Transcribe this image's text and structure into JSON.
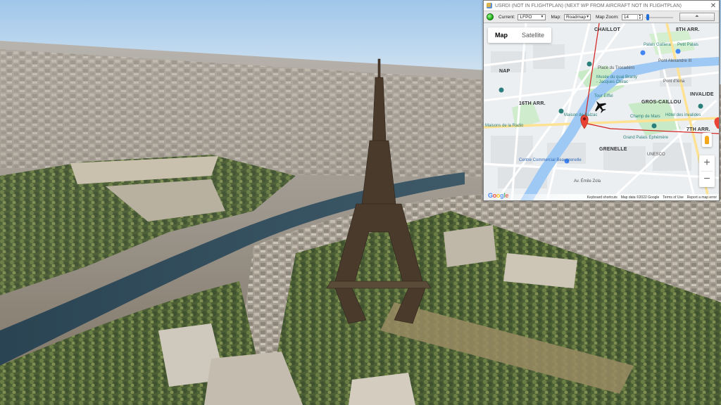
{
  "window": {
    "title": "USRDI (NOT IN FLIGHTPLAN) (NEXT WP FROM AIRCRAFT NOT IN FLIGHTPLAN)",
    "close_glyph": "✕"
  },
  "toolbar": {
    "current_label": "Current:",
    "current_value": "LFPO",
    "map_label": "Map:",
    "map_value": "Roadmap",
    "zoom_label": "Map Zoom:",
    "zoom_value": "14",
    "zoom_slider_fraction": 0.05
  },
  "map": {
    "type_tabs": [
      "Map",
      "Satellite"
    ],
    "active_tab": "Map",
    "zoom_in": "+",
    "zoom_out": "−",
    "labels": {
      "chaillot": "CHAILLOT",
      "arr8": "8TH ARR.",
      "palais_galliera": "Palais Galliera",
      "petit_palais": "Petit Palais",
      "place_trocadero": "Place du Trocadéro",
      "musee_quai": "Musée du quai Branly",
      "jacques_chirac": "- Jacques Chirac",
      "pont_alexandre": "Pont Alexandre III",
      "pont_invalides": "Pont d'Iéna",
      "nap": "NAP",
      "arr16": "16TH ARR.",
      "tour_eiffel": "Tour Eiffel",
      "gros_caillou": "GROS-CAILLOU",
      "invalides": "INVALIDE",
      "hotel_invalides": "Hôtel des invalides",
      "maison_balzac": "Maison de Balzac",
      "champ_de_mars": "Champ de Mars",
      "maisons_radio": "Maisons de la Radio",
      "arr7": "7TH ARR.",
      "grenelle": "GRENELLE",
      "grand_palais": "Grand Palais Ephémère",
      "unesco": "UNESCO",
      "centre_beaugrenelle": "Centre Commercial Beaugrenelle",
      "rue_emile_zola": "Av. Émile Zola"
    },
    "attribution": {
      "shortcuts": "Keyboard shortcuts",
      "data": "Map data ©2022 Google",
      "terms": "Terms of Use",
      "report": "Report a map error"
    },
    "logo": [
      "G",
      "o",
      "o",
      "g",
      "l",
      "e"
    ]
  },
  "colors": {
    "route": "#d41d1d",
    "water": "#9ec9f5",
    "park": "#c9eac7",
    "status_ok": "#1aa51a"
  }
}
